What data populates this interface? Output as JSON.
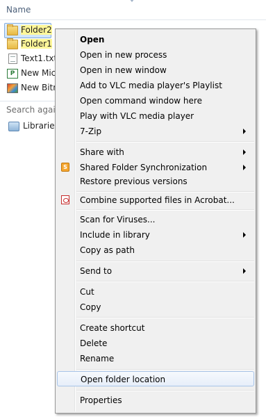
{
  "explorer": {
    "column_header": "Name",
    "files": [
      {
        "name": "Folder2",
        "icon": "folder-icon"
      },
      {
        "name": "Folder1",
        "icon": "folder-icon"
      },
      {
        "name": "Text1.txt",
        "icon": "text-file-icon"
      },
      {
        "name": "New Micr",
        "icon": "publisher-file-icon"
      },
      {
        "name": "New Bitm",
        "icon": "bitmap-file-icon"
      }
    ],
    "search_again": "Search again",
    "libraries": "Libraries"
  },
  "context_menu": {
    "groups": [
      [
        {
          "label": "Open",
          "bold": true,
          "submenu": false
        },
        {
          "label": "Open in new process",
          "submenu": false
        },
        {
          "label": "Open in new window",
          "submenu": false
        },
        {
          "label": "Add to VLC media player's Playlist",
          "submenu": false
        },
        {
          "label": "Open command window here",
          "submenu": false
        },
        {
          "label": "Play with VLC media player",
          "submenu": false
        },
        {
          "label": "7-Zip",
          "submenu": true
        }
      ],
      [
        {
          "label": "Share with",
          "submenu": true
        },
        {
          "label": "Shared Folder Synchronization",
          "submenu": true,
          "icon": "sync-icon"
        },
        {
          "label": "Restore previous versions",
          "submenu": false
        }
      ],
      [
        {
          "label": "Combine supported files in Acrobat...",
          "submenu": false,
          "icon": "acrobat-icon"
        }
      ],
      [
        {
          "label": "Scan for Viruses...",
          "submenu": false
        },
        {
          "label": "Include in library",
          "submenu": true
        },
        {
          "label": "Copy as path",
          "submenu": false
        }
      ],
      [
        {
          "label": "Send to",
          "submenu": true
        }
      ],
      [
        {
          "label": "Cut",
          "submenu": false
        },
        {
          "label": "Copy",
          "submenu": false
        }
      ],
      [
        {
          "label": "Create shortcut",
          "submenu": false
        },
        {
          "label": "Delete",
          "submenu": false
        },
        {
          "label": "Rename",
          "submenu": false
        }
      ],
      [
        {
          "label": "Open folder location",
          "submenu": false,
          "highlighted": true
        }
      ],
      [
        {
          "label": "Properties",
          "submenu": false
        }
      ]
    ]
  },
  "colors": {
    "menu_background": "#f0f0f0",
    "highlight_border": "#a8c4e8",
    "selection_border": "#84acdd",
    "search_highlight": "#fff799"
  }
}
